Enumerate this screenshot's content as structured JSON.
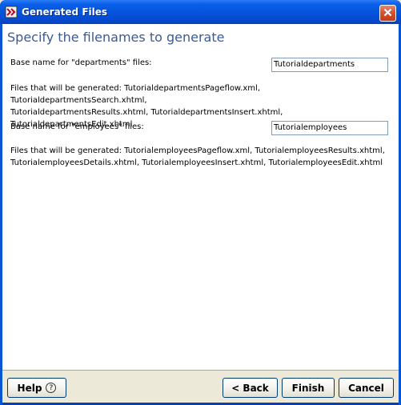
{
  "window": {
    "title": "Generated Files"
  },
  "heading": "Specify the filenames to generate",
  "departments": {
    "label": "Base name for \"departments\" files:",
    "value": "Tutorialdepartments",
    "info_line1": "Files that will be generated: TutorialdepartmentsPageflow.xml, TutorialdepartmentsSearch.xhtml,",
    "info_line2": "TutorialdepartmentsResults.xhtml, TutorialdepartmentsInsert.xhtml, TutorialdepartmentsEdit.xhtml"
  },
  "employees": {
    "label": "Base name for \"employees\" files:",
    "value": "Tutorialemployees",
    "info_line1": "Files that will be generated: TutorialemployeesPageflow.xml, TutorialemployeesResults.xhtml,",
    "info_line2": "TutorialemployeesDetails.xhtml, TutorialemployeesInsert.xhtml, TutorialemployeesEdit.xhtml"
  },
  "buttons": {
    "help": "Help",
    "help_glyph": "?",
    "back": "< Back",
    "finish": "Finish",
    "cancel": "Cancel"
  },
  "icons": {
    "app": "app-icon",
    "close": "close-icon",
    "help": "help-icon"
  },
  "colors": {
    "title_bar": "#0553dc",
    "heading": "#3a5a98",
    "close_button": "#d8512e"
  }
}
